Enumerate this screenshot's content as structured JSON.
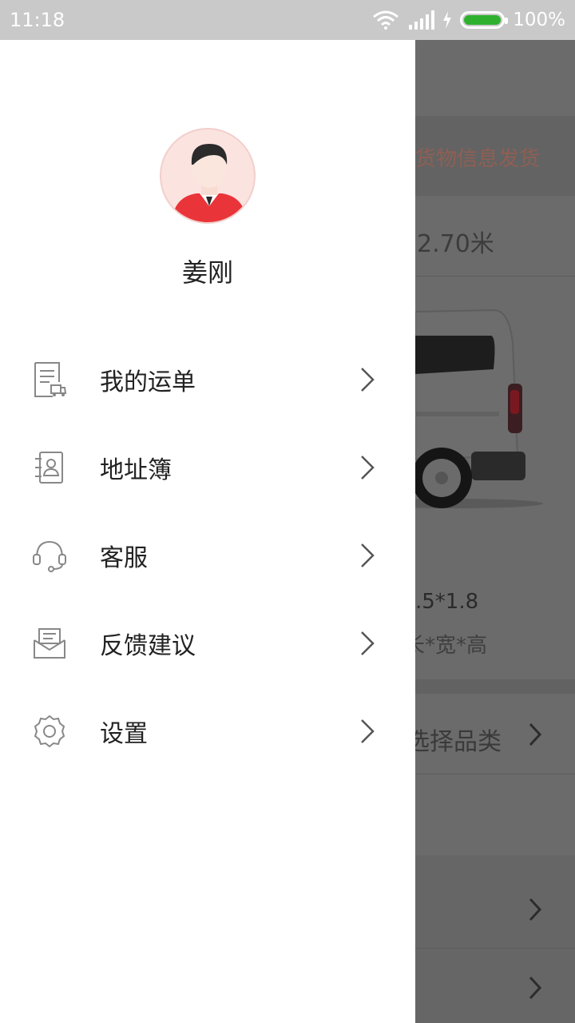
{
  "status_bar": {
    "time": "11:18",
    "battery": "100%",
    "battery_level": 1.0,
    "icons": [
      "wifi-icon",
      "signal-icon",
      "charging-icon",
      "battery-icon"
    ]
  },
  "drawer": {
    "user": {
      "name": "姜刚",
      "avatar": "avatar-icon"
    },
    "items": [
      {
        "label": "我的运单",
        "icon": "waybill-icon"
      },
      {
        "label": "地址簿",
        "icon": "address-book-icon"
      },
      {
        "label": "客服",
        "icon": "headset-icon"
      },
      {
        "label": "反馈建议",
        "icon": "feedback-icon"
      },
      {
        "label": "设置",
        "icon": "settings-icon"
      }
    ]
  },
  "background": {
    "banner_text": "货物信息发货",
    "length_text": "2.70米",
    "dims_text": ".5*1.8",
    "dims_label": "长*宽*高",
    "category_text": "选择品类"
  },
  "colors": {
    "status_bar": "#c9c9c9",
    "overlay": "#6b6b6b",
    "accent": "#e23b3b",
    "text": "#222222"
  }
}
